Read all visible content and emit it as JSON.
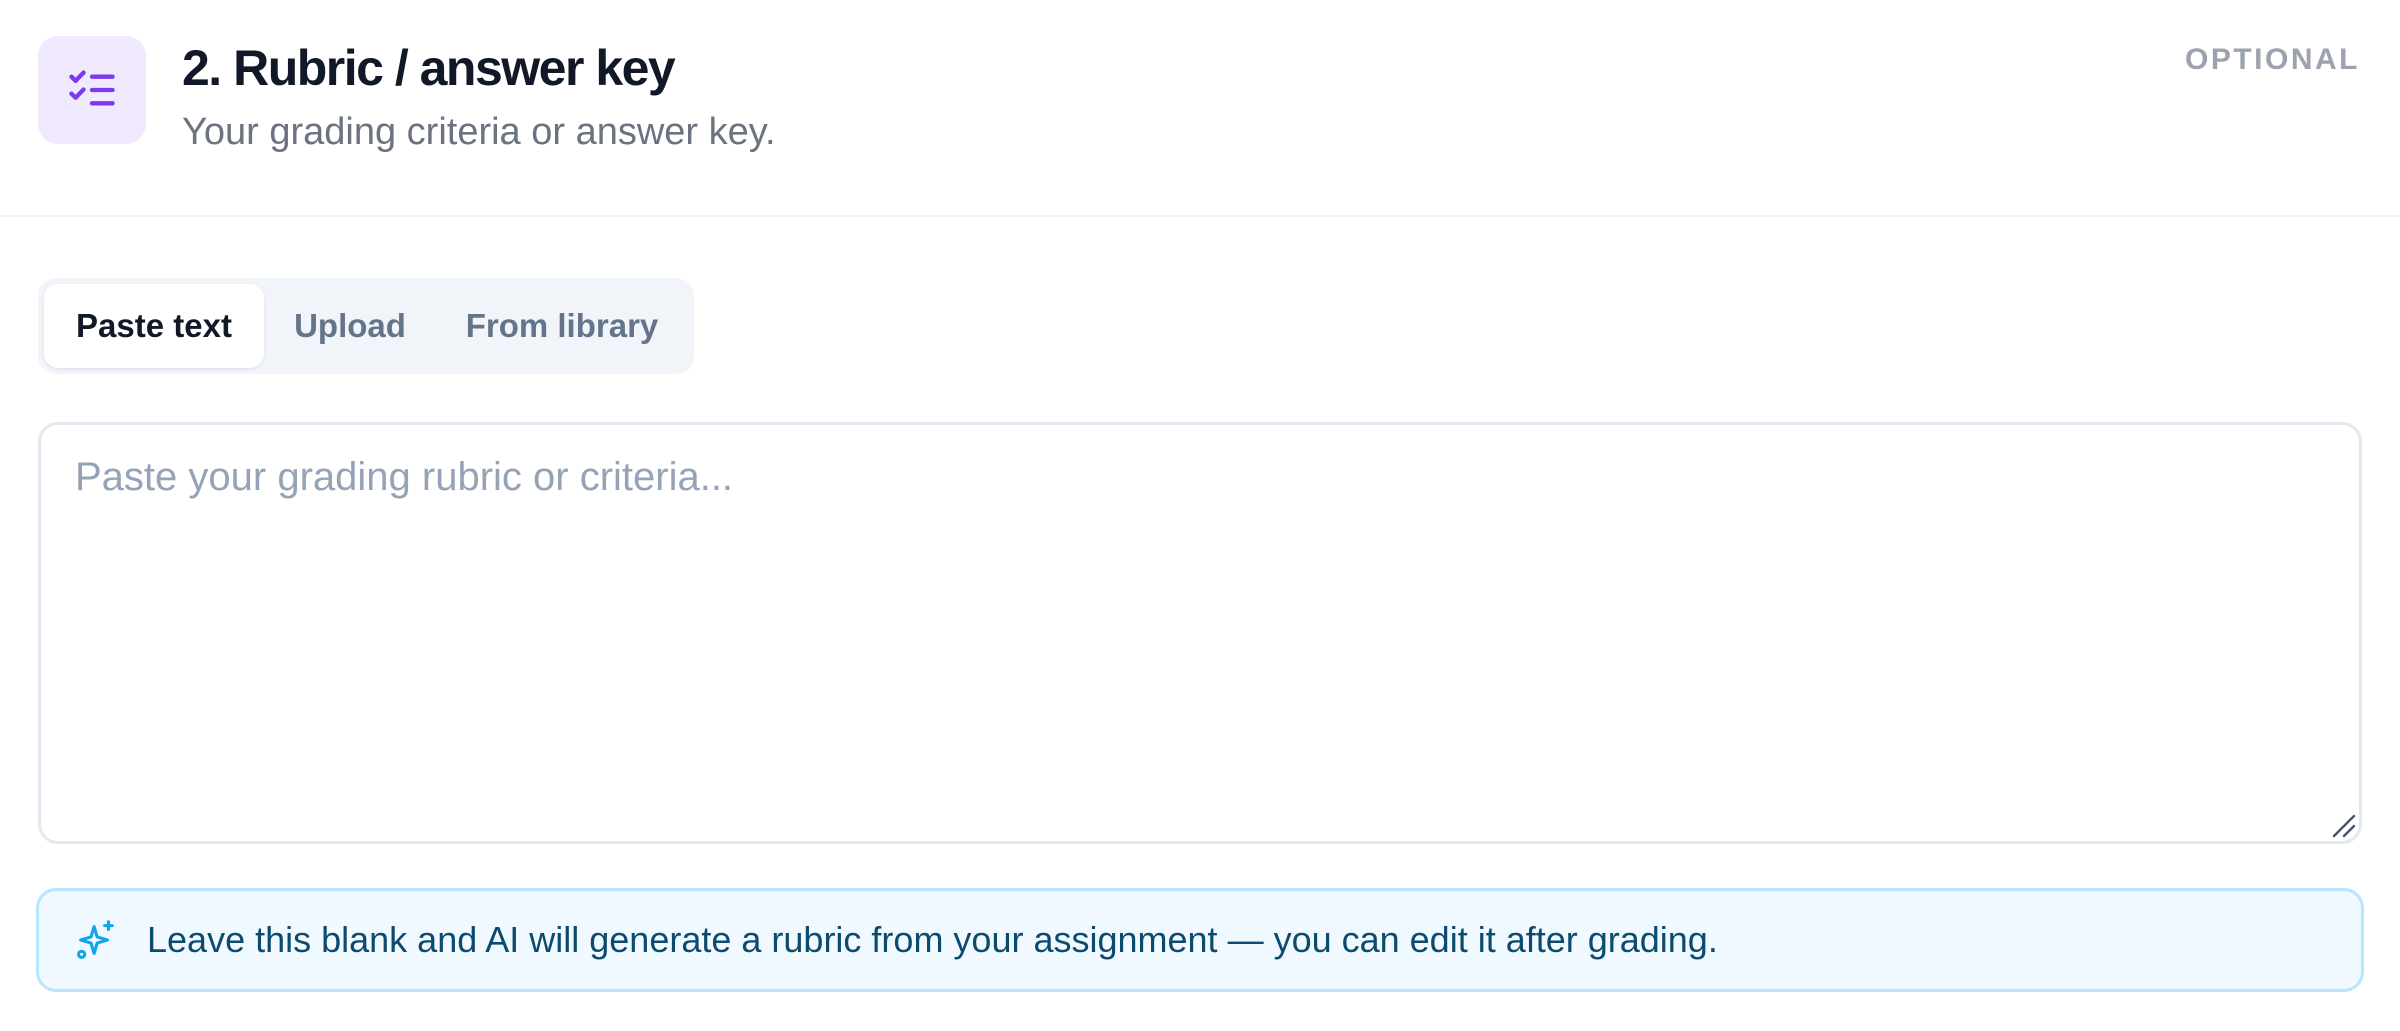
{
  "header": {
    "icon": "checklist-icon",
    "title": "2. Rubric / answer key",
    "subtitle": "Your grading criteria or answer key.",
    "badge": "OPTIONAL"
  },
  "tabs": [
    {
      "label": "Paste text",
      "active": true
    },
    {
      "label": "Upload",
      "active": false
    },
    {
      "label": "From library",
      "active": false
    }
  ],
  "rubric_input": {
    "value": "",
    "placeholder": "Paste your grading rubric or criteria..."
  },
  "hint": {
    "icon": "sparkles-icon",
    "text": "Leave this blank and AI will generate a rubric from your assignment — you can edit it after grading."
  },
  "colors": {
    "icon_bg": "#f1e9fe",
    "icon_accent": "#7c3aed",
    "hint_bg": "#f0f9ff",
    "hint_border": "#bae6fd",
    "hint_text": "#0c4a6e",
    "hint_icon": "#0ea5e9"
  }
}
